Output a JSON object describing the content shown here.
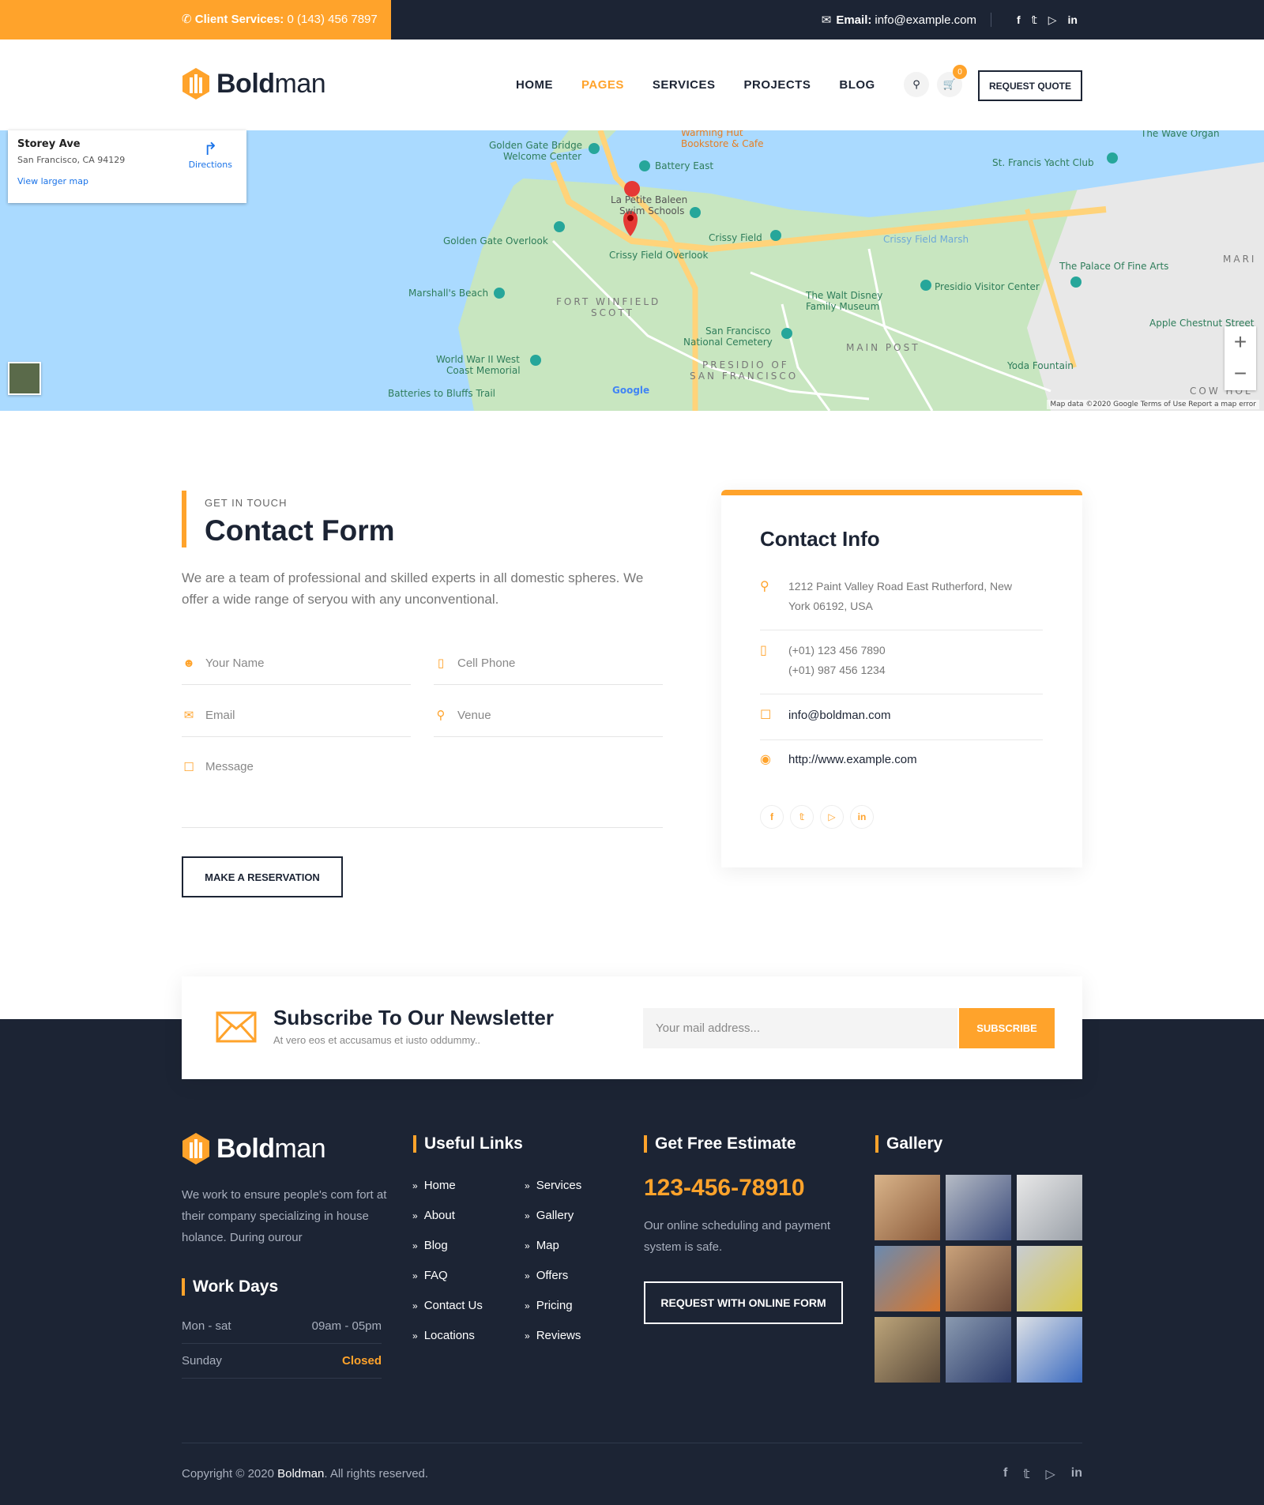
{
  "topbar": {
    "client_label": "Client Services:",
    "client_phone": "0 (143) 456 7897",
    "email_label": "Email:",
    "email_value": "info@example.com",
    "social": [
      "f",
      "t",
      "yt",
      "in"
    ]
  },
  "brand": {
    "bold": "Bold",
    "rest": "man"
  },
  "nav": {
    "items": [
      "HOME",
      "PAGES",
      "SERVICES",
      "PROJECTS",
      "BLOG"
    ],
    "active": "PAGES",
    "cart_count": "0",
    "quote_label": "REQUEST QUOTE"
  },
  "map": {
    "card_title": "Storey Ave",
    "card_address": "San Francisco, CA 94129",
    "card_link": "View larger map",
    "directions": "Directions",
    "footer": "Map data ©2020 Google   Terms of Use   Report a map error",
    "labels": [
      "Golden Gate Bridge",
      "Welcome Center",
      "Warming Hut",
      "Bookstore & Cafe",
      "Battery East",
      "La Petite Baleen",
      "Swim Schools",
      "Golden Gate Overlook",
      "Crissy Field",
      "Crissy Field Overlook",
      "Marshall's Beach",
      "FORT WINFIELD",
      "SCOTT",
      "The Walt Disney",
      "Family Museum",
      "Presidio Visitor Center",
      "San Francisco",
      "National Cemetery",
      "MAIN POST",
      "PRESIDIO OF",
      "SAN FRANCISCO",
      "World War II West",
      "Coast Memorial",
      "Batteries to Bluffs Trail",
      "Yoda Fountain",
      "The Palace Of Fine Arts",
      "Apple Chestnut Street",
      "St. Francis Yacht Club",
      "The Wave Organ",
      "Crissy Field Marsh",
      "MARI",
      "COW HOL",
      "Google"
    ]
  },
  "contact": {
    "kicker": "GET IN TOUCH",
    "title": "Contact Form",
    "intro": "We are a team of professional and skilled experts in all domestic spheres. We offer a wide range of seryou with any unconventional.",
    "fields": {
      "name": "Your Name",
      "phone": "Cell Phone",
      "email": "Email",
      "venue": "Venue",
      "message": "Message"
    },
    "submit": "MAKE A RESERVATION"
  },
  "info": {
    "title": "Contact Info",
    "address_1": "1212 Paint Valley Road East Rutherford, New",
    "address_2": "York 06192, USA",
    "phone_1": "(+01) 123 456 7890",
    "phone_2": "(+01) 987 456 1234",
    "email": "info@boldman.com",
    "website": "http://www.example.com"
  },
  "newsletter": {
    "title": "Subscribe To Our Newsletter",
    "subtitle": "At vero eos et accusamus et iusto oddummy..",
    "placeholder": "Your mail address...",
    "button": "SUBSCRIBE"
  },
  "footer": {
    "about": "We work to ensure people's com fort at their company specializing in house holance. During ourour",
    "work_days_title": "Work Days",
    "work_days": [
      {
        "day": "Mon - sat",
        "hours": "09am - 05pm"
      },
      {
        "day": "Sunday",
        "hours": "Closed"
      }
    ],
    "links_title": "Useful Links",
    "links_col1": [
      "Home",
      "About",
      "Blog",
      "FAQ",
      "Contact Us",
      "Locations"
    ],
    "links_col2": [
      "Services",
      "Gallery",
      "Map",
      "Offers",
      "Pricing",
      "Reviews"
    ],
    "estimate_title": "Get Free Estimate",
    "estimate_phone": "123-456-78910",
    "estimate_text": "Our online scheduling and payment system is safe.",
    "estimate_button": "REQUEST WITH ONLINE FORM",
    "gallery_title": "Gallery",
    "copyright_pre": "Copyright © 2020",
    "copyright_brand": "Boldman",
    "copyright_post": ". All rights reserved."
  },
  "colors": {
    "accent": "#ffa32b",
    "dark": "#1c2434"
  }
}
